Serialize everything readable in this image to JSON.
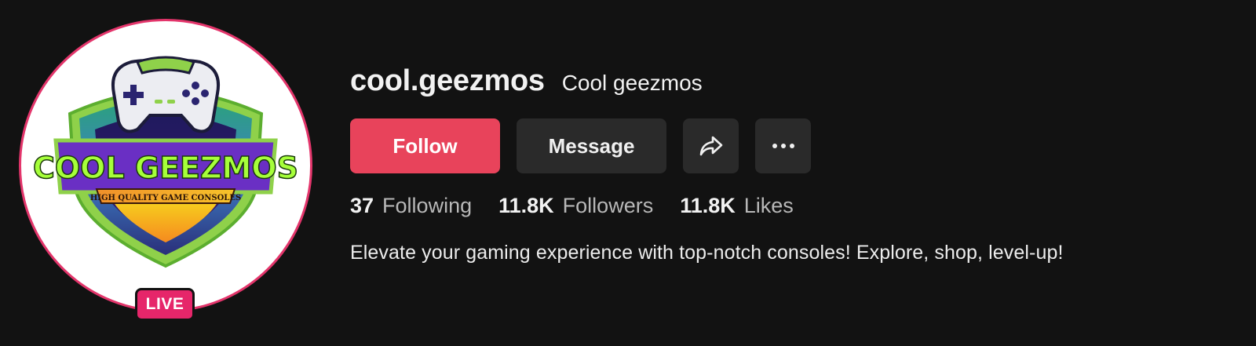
{
  "profile": {
    "username": "cool.geezmos",
    "nickname": "Cool geezmos",
    "live_badge": "LIVE",
    "logo": {
      "title": "COOL GEEZMOS",
      "tagline": "HIGH QUALITY GAME CONSOLES"
    },
    "bio": "Elevate your gaming experience with top-notch consoles! Explore, shop, level-up!"
  },
  "actions": {
    "follow_label": "Follow",
    "message_label": "Message",
    "share_icon": "share-icon",
    "more_icon": "more-options-icon"
  },
  "stats": [
    {
      "value": "37",
      "label": "Following"
    },
    {
      "value": "11.8K",
      "label": "Followers"
    },
    {
      "value": "11.8K",
      "label": "Likes"
    }
  ],
  "colors": {
    "background": "#121212",
    "follow_button": "#e8435b",
    "secondary_button": "#2a2a2a",
    "live_badge": "#e6266a",
    "avatar_ring": "#e3356b"
  }
}
